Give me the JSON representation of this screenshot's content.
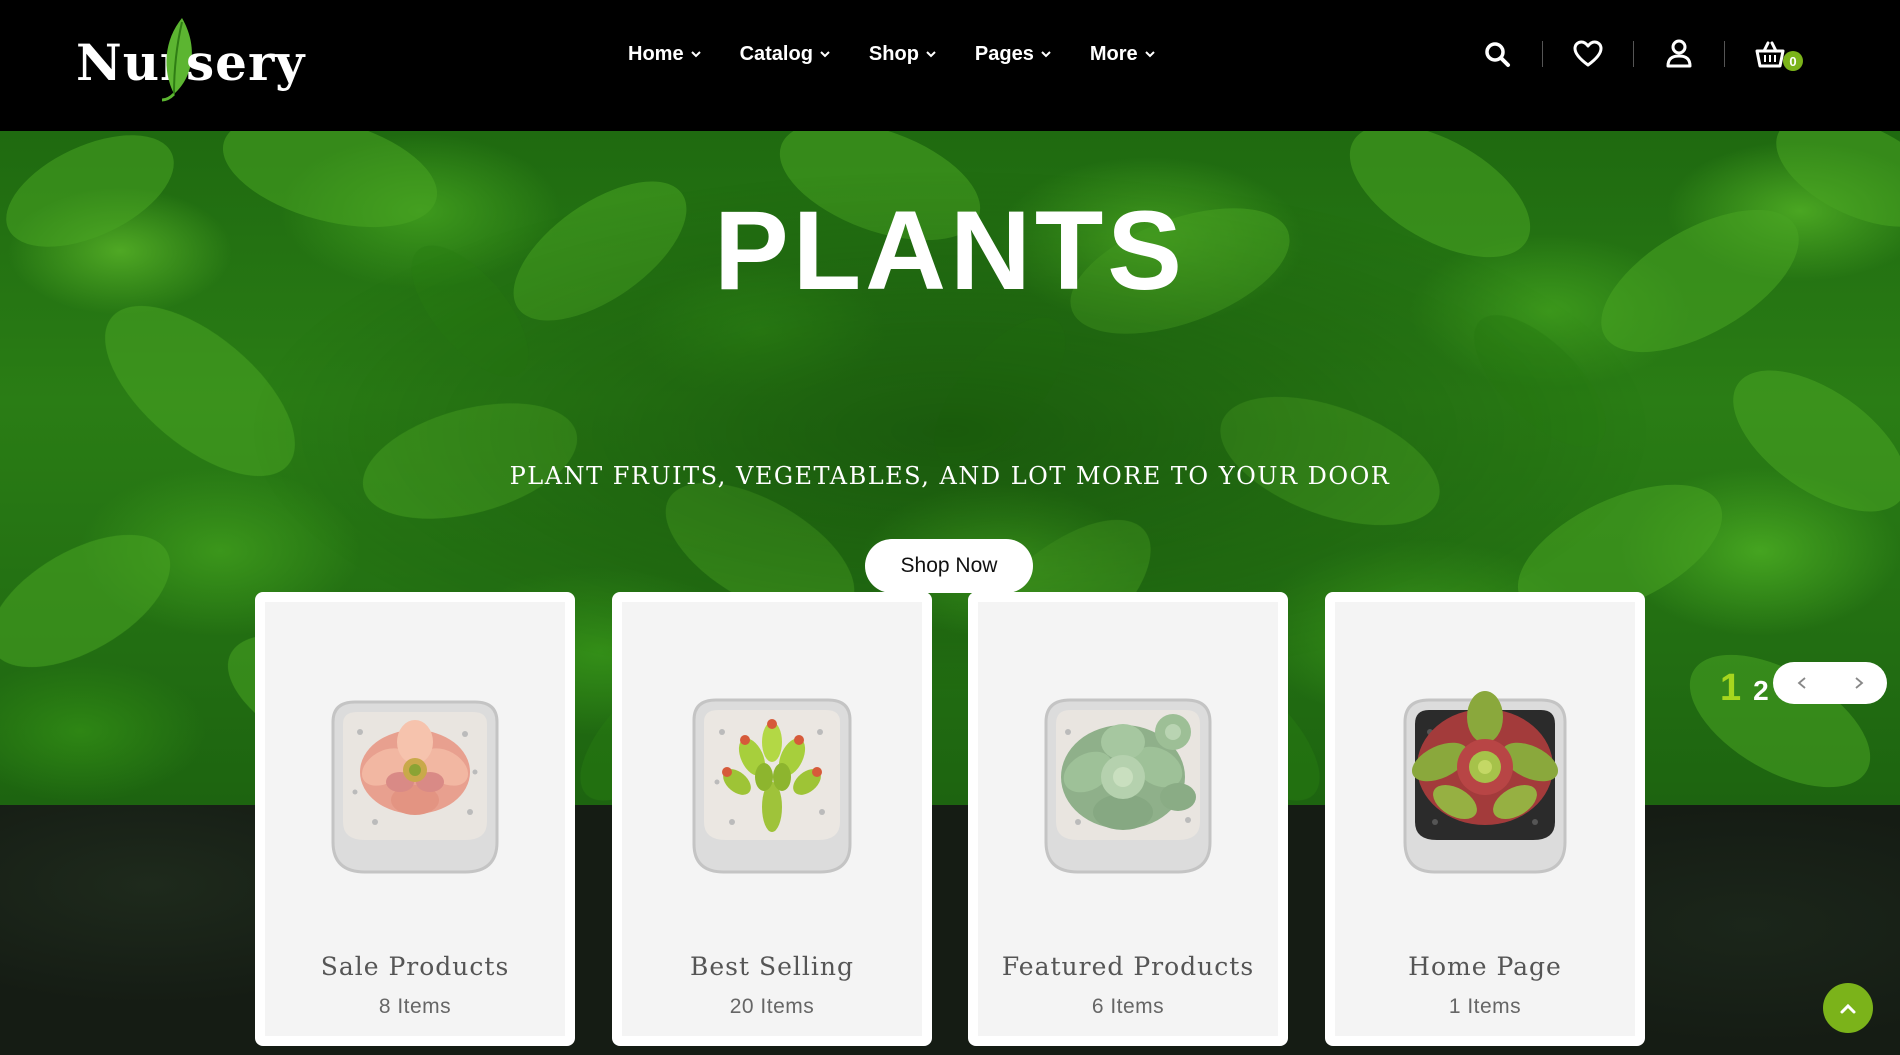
{
  "brand": {
    "logo_text_left": "Nur",
    "logo_text_right": "sery",
    "leaf_color": "#5cb531"
  },
  "nav": {
    "items": [
      {
        "label": "Home"
      },
      {
        "label": "Catalog"
      },
      {
        "label": "Shop"
      },
      {
        "label": "Pages"
      },
      {
        "label": "More"
      }
    ]
  },
  "header_icons": {
    "search": "search-icon",
    "wishlist": "heart-icon",
    "account": "user-icon",
    "cart": "basket-icon",
    "cart_count": "0"
  },
  "hero": {
    "title": "PLANTS",
    "subtitle": "PLANT FRUITS, VEGETABLES, AND LOT MORE TO YOUR DOOR",
    "cta_label": "Shop Now"
  },
  "categories": [
    {
      "title": "Sale Products",
      "count": "8 Items"
    },
    {
      "title": "Best Selling",
      "count": "20 Items"
    },
    {
      "title": "Featured Products",
      "count": "6 Items"
    },
    {
      "title": "Home Page",
      "count": "1 Items"
    }
  ],
  "slider": {
    "page_current": "1",
    "page_next": "2"
  },
  "colors": {
    "accent": "#7bb31a",
    "pager_active": "#a6d61e",
    "header_bg": "#000000"
  }
}
